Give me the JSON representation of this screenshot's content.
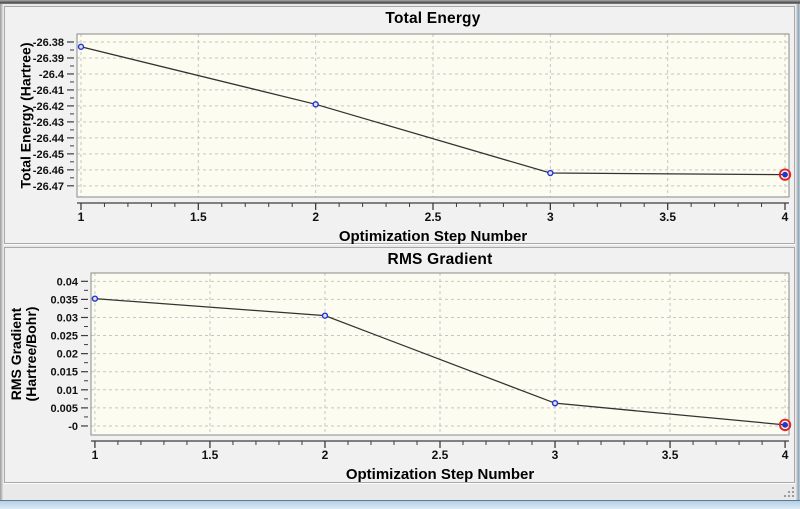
{
  "window": {
    "background": "#e9e9e9",
    "top_edge_color": "#4f4f4f",
    "bottom_edge_color": "#b4d0e6",
    "panel_background": "#f1f1f1",
    "panel_border": "#a9a9a9"
  },
  "chart_data": [
    {
      "type": "line",
      "title": "Total Energy",
      "xlabel": "Optimization Step Number",
      "ylabel": "Total Energy (Hartree)",
      "ylabel_lines": [
        "Total Energy (Hartree)"
      ],
      "x": [
        1,
        2,
        3,
        4
      ],
      "y": [
        -26.383,
        -26.419,
        -26.462,
        -26.463
      ],
      "xlim": [
        0.983,
        4.017
      ],
      "ylim": [
        -26.477,
        -26.375
      ],
      "xticks": [
        1,
        1.5,
        2,
        2.5,
        3,
        3.5,
        4
      ],
      "xtick_labels": [
        "1",
        "1.5",
        "2",
        "2.5",
        "3",
        "3.5",
        "4"
      ],
      "xminor_step": 0.1,
      "yticks": [
        -26.38,
        -26.39,
        -26.4,
        -26.41,
        -26.42,
        -26.43,
        -26.44,
        -26.45,
        -26.46,
        -26.47
      ],
      "ytick_labels": [
        "-26.38",
        "-26.39",
        "-26.4",
        "-26.41",
        "-26.42",
        "-26.43",
        "-26.44",
        "-26.45",
        "-26.46",
        "-26.47"
      ],
      "grid": true,
      "legend": null,
      "selected_index": 3,
      "line_color": "#323232",
      "marker_stroke": "#2633cc",
      "marker_fill": "#dce4fa",
      "selected_ring_color": "#e02424",
      "plot_bg": "#fcfcf0",
      "grid_color": "#c6c6c6",
      "axis_color": "#3c3c3c",
      "tick_label_color": "#111111"
    },
    {
      "type": "line",
      "title": "RMS Gradient",
      "xlabel": "Optimization Step Number",
      "ylabel": "RMS Gradient (Hartree/Bohr)",
      "ylabel_lines": [
        "RMS Gradient",
        "(Hartree/Bohr)"
      ],
      "x": [
        1,
        2,
        3,
        4
      ],
      "y": [
        0.0352,
        0.0305,
        0.0063,
        0.0003
      ],
      "xlim": [
        0.983,
        4.017
      ],
      "ylim": [
        -0.0025,
        0.0423
      ],
      "xticks": [
        1,
        1.5,
        2,
        2.5,
        3,
        3.5,
        4
      ],
      "xtick_labels": [
        "1",
        "1.5",
        "2",
        "2.5",
        "3",
        "3.5",
        "4"
      ],
      "xminor_step": 0.1,
      "yticks": [
        0.04,
        0.035,
        0.03,
        0.025,
        0.02,
        0.015,
        0.01,
        0.005,
        0
      ],
      "ytick_labels": [
        "0.04",
        "0.035",
        "0.03",
        "0.025",
        "0.02",
        "0.015",
        "0.01",
        "0.005",
        "-0"
      ],
      "grid": true,
      "legend": null,
      "selected_index": 3,
      "line_color": "#323232",
      "marker_stroke": "#2633cc",
      "marker_fill": "#dce4fa",
      "selected_ring_color": "#e02424",
      "plot_bg": "#fcfcf0",
      "grid_color": "#c6c6c6",
      "axis_color": "#3c3c3c",
      "tick_label_color": "#111111"
    }
  ]
}
